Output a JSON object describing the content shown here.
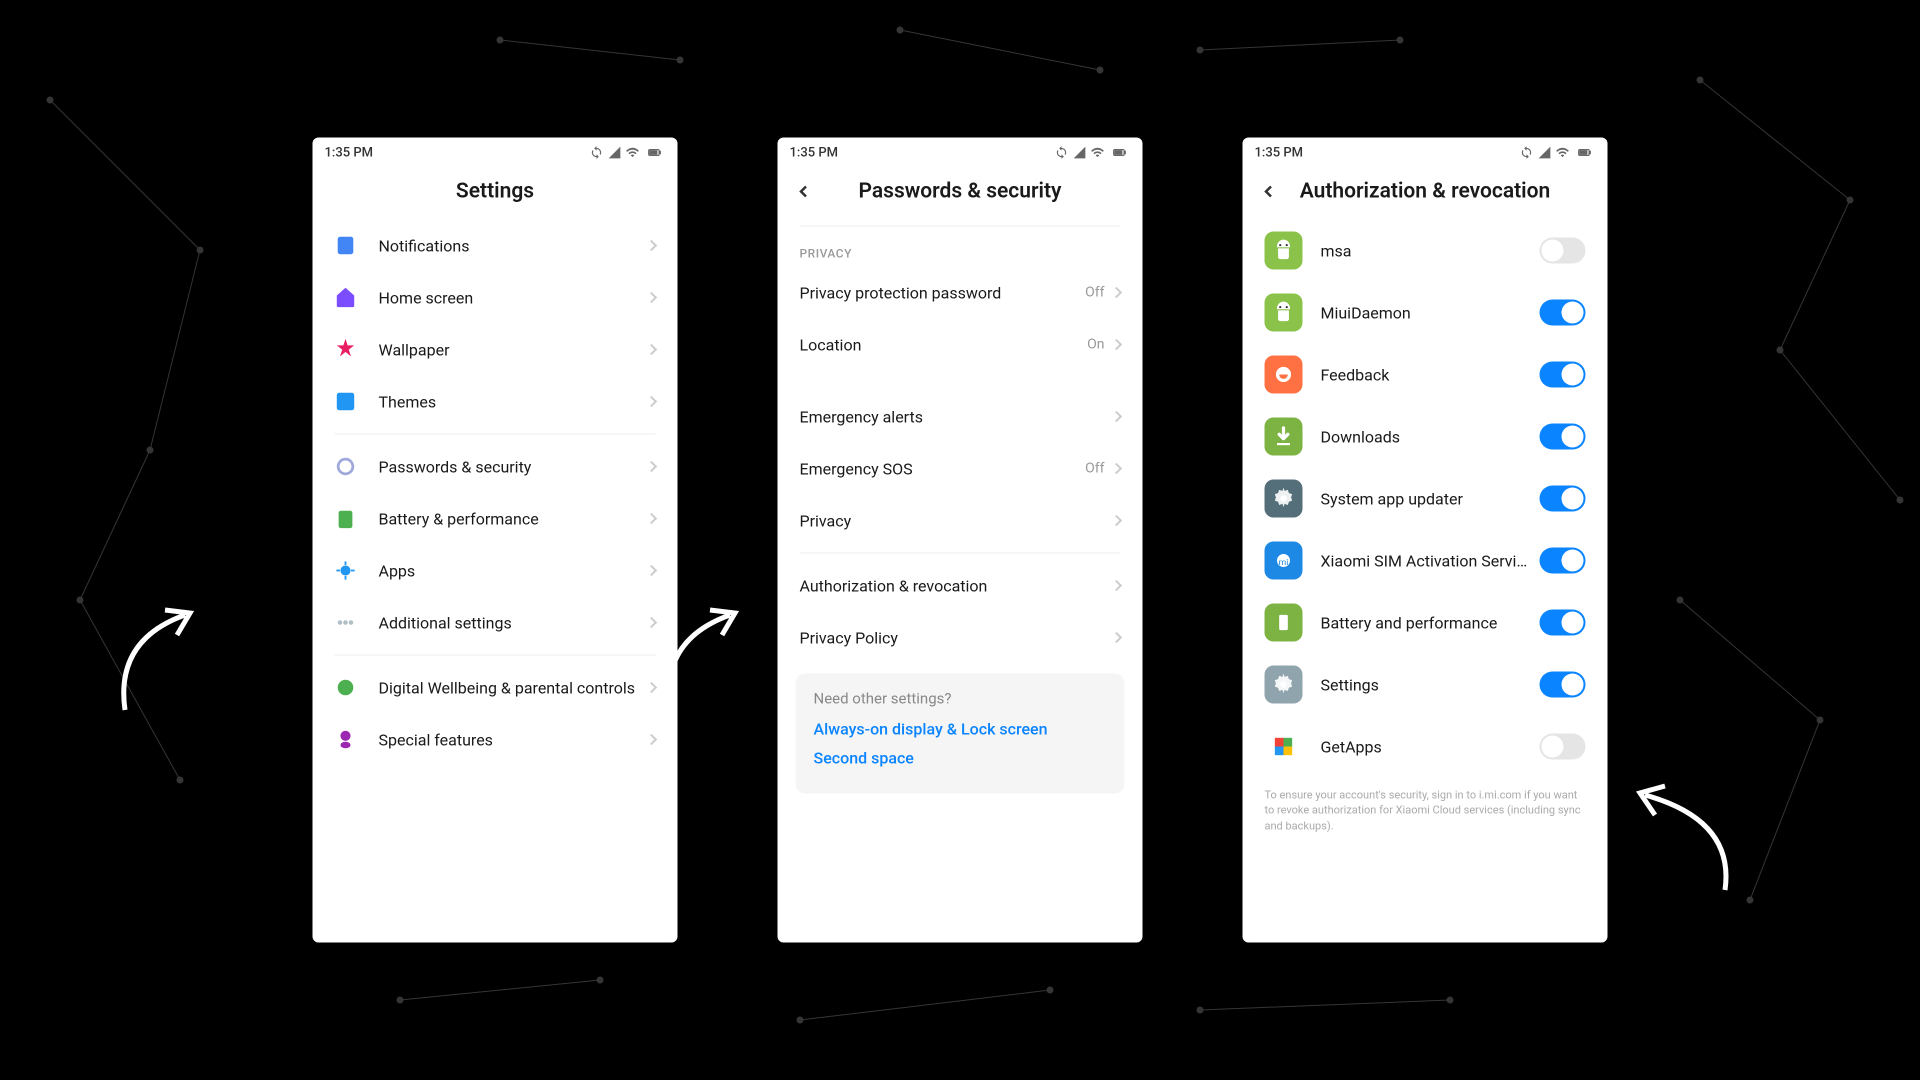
{
  "status_bar": {
    "time": "1:35 PM"
  },
  "screen1": {
    "title": "Settings",
    "items": [
      {
        "label": "Notifications",
        "icon": "notifications",
        "color": "#4285f4"
      },
      {
        "label": "Home screen",
        "icon": "home",
        "color": "#7c4dff"
      },
      {
        "label": "Wallpaper",
        "icon": "wallpaper",
        "color": "#e91e63"
      },
      {
        "label": "Themes",
        "icon": "themes",
        "color": "#2196f3"
      }
    ],
    "items2": [
      {
        "label": "Passwords & security",
        "icon": "security",
        "color": "#9fa8da"
      },
      {
        "label": "Battery & performance",
        "icon": "battery",
        "color": "#4caf50"
      },
      {
        "label": "Apps",
        "icon": "apps",
        "color": "#2196f3"
      },
      {
        "label": "Additional settings",
        "icon": "more",
        "color": "#b0bec5"
      }
    ],
    "items3": [
      {
        "label": "Digital Wellbeing & parental controls",
        "icon": "wellbeing",
        "color": "#4caf50"
      },
      {
        "label": "Special features",
        "icon": "special",
        "color": "#9c27b0"
      }
    ]
  },
  "screen2": {
    "title": "Passwords & security",
    "privacy_label": "PRIVACY",
    "items1": [
      {
        "label": "Privacy protection password",
        "value": "Off"
      },
      {
        "label": "Location",
        "value": "On"
      }
    ],
    "items2": [
      {
        "label": "Emergency alerts",
        "value": ""
      },
      {
        "label": "Emergency SOS",
        "value": "Off"
      },
      {
        "label": "Privacy",
        "value": ""
      }
    ],
    "items3": [
      {
        "label": "Authorization & revocation",
        "value": ""
      },
      {
        "label": "Privacy Policy",
        "value": ""
      }
    ],
    "other": {
      "label": "Need other settings?",
      "links": [
        "Always-on display & Lock screen",
        "Second space"
      ]
    }
  },
  "screen3": {
    "title": "Authorization & revocation",
    "apps": [
      {
        "label": "msa",
        "on": false,
        "color": "#8bc34a",
        "icon": "android"
      },
      {
        "label": "MiuiDaemon",
        "on": true,
        "color": "#8bc34a",
        "icon": "android"
      },
      {
        "label": "Feedback",
        "on": true,
        "color": "#ff7043",
        "icon": "feedback"
      },
      {
        "label": "Downloads",
        "on": true,
        "color": "#7cb342",
        "icon": "download"
      },
      {
        "label": "System app updater",
        "on": true,
        "color": "#546e7a",
        "icon": "gear"
      },
      {
        "label": "Xiaomi SIM Activation Servi…",
        "on": true,
        "color": "#1e88e5",
        "icon": "sim"
      },
      {
        "label": "Battery and performance",
        "on": true,
        "color": "#7cb342",
        "icon": "battery"
      },
      {
        "label": "Settings",
        "on": true,
        "color": "#90a4ae",
        "icon": "gear"
      },
      {
        "label": "GetApps",
        "on": false,
        "color": "#ffffff",
        "icon": "getapps"
      }
    ],
    "footnote": "To ensure your account's security, sign in to i.mi.com if you want to revoke authorization for Xiaomi Cloud services (including sync and backups)."
  }
}
